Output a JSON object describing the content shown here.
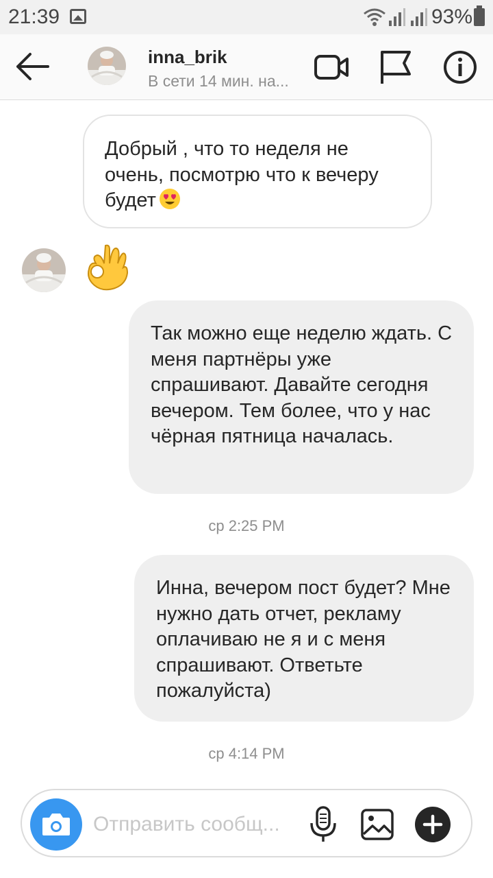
{
  "status_bar": {
    "time": "21:39",
    "battery": "93%",
    "icons": [
      "gallery-icon",
      "wifi-icon",
      "signal-icon",
      "battery-icon"
    ]
  },
  "header": {
    "username": "inna_brik",
    "status": "В сети 14 мин. на...",
    "icons": [
      "back-arrow-icon",
      "video-call-icon",
      "flag-icon",
      "info-icon"
    ]
  },
  "messages": [
    {
      "direction": "incoming",
      "text": "Добрый , что то неделя не очень, посмотрю что к вечеру будет",
      "emoji": "heart-eyes-emoji"
    },
    {
      "direction": "incoming",
      "emoji": "ok-hand-emoji"
    },
    {
      "direction": "outgoing",
      "text": "Так можно еще неделю ждать. С меня партнёры уже спрашивают. Давайте сегодня вечером. Тем более, что у нас чёрная пятница началась."
    },
    {
      "direction": "outgoing",
      "text": "Инна, вечером пост будет? Мне нужно дать отчет, рекламу оплачиваю не я и с меня спрашивают. Ответьте пожалуйста)"
    }
  ],
  "timestamps": [
    "ср 2:25 PM",
    "ср 4:14 PM"
  ],
  "composer": {
    "placeholder": "Отправить сообщ...",
    "icons": [
      "camera-icon",
      "microphone-icon",
      "gallery-icon",
      "plus-icon"
    ]
  },
  "colors": {
    "accent": "#3897f0",
    "bubble_out": "#efefef",
    "text": "#262626",
    "muted": "#8e8e8e"
  }
}
